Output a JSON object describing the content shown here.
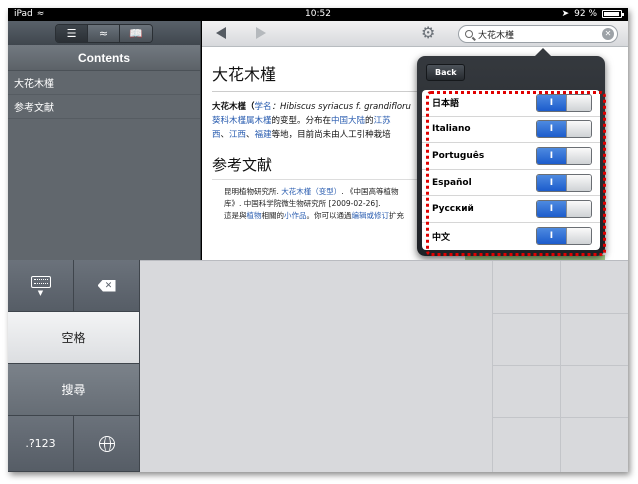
{
  "status": {
    "carrier": "iPad",
    "time": "10:52",
    "battery": "92 %",
    "battery_level": 0.92
  },
  "sidebar": {
    "title": "Contents",
    "toolbar": {
      "list_icon": "list-icon",
      "wave_icon": "approx-icon",
      "book_icon": "book-icon"
    },
    "items": [
      {
        "label": "大花木槿"
      },
      {
        "label": "参考文献"
      }
    ]
  },
  "main": {
    "search": {
      "value": "大花木槿"
    },
    "article": {
      "title": "大花木槿",
      "intro_line1": {
        "a": "大花木槿（",
        "b": "学名",
        "c": "：Hibiscus syriacus f. grandifloru"
      },
      "intro_line2": {
        "a": "葵科木槿属木槿",
        "b": "的变型。分布在",
        "c": "中国大陆",
        "d": "的",
        "e": "江苏"
      },
      "intro_line3": {
        "a": "西",
        "b": "、",
        "c": "江西",
        "d": "、",
        "e": "福建",
        "f": "等地，目前尚未由人工引种栽培"
      },
      "refs_title": "参考文献",
      "ref1": {
        "a": "昆明植物研究所.",
        "b": "大花木槿（变型）",
        "c": ". 《中国高等植物"
      },
      "ref2": {
        "a": "库》. 中国科学院微生物研究所 [2009-02-26]."
      },
      "note": {
        "a": "這是與",
        "b": "植物",
        "c": "相關的",
        "d": "小作品",
        "e": "。你可以通過",
        "f": "编辑或修订",
        "g": "扩充"
      }
    }
  },
  "popover": {
    "back_label": "Back",
    "languages": [
      {
        "label": "日本語",
        "toggle": "I"
      },
      {
        "label": "Italiano",
        "toggle": "I"
      },
      {
        "label": "Português",
        "toggle": "I"
      },
      {
        "label": "Español",
        "toggle": "I"
      },
      {
        "label": "Русский",
        "toggle": "I"
      },
      {
        "label": "中文",
        "toggle": "I"
      }
    ]
  },
  "keyboard": {
    "space_label": "空格",
    "search_label": "搜尋",
    "numbers_label": ".?123"
  }
}
